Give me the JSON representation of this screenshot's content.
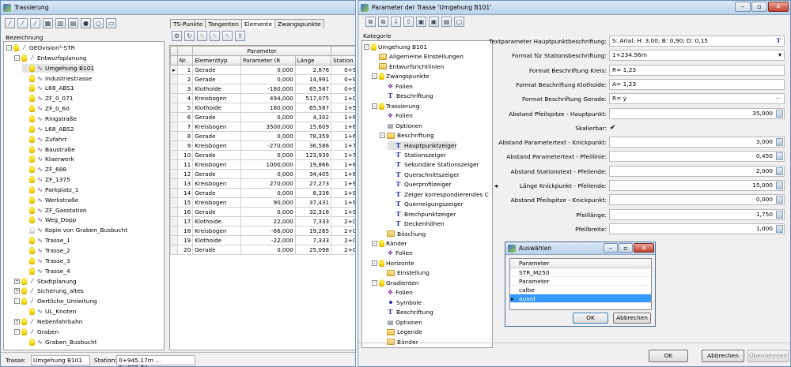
{
  "left": {
    "title": "Trassierung",
    "bezeichnung": "Bezeichnung",
    "tree": [
      {
        "label": "GEOvision³-STR",
        "lvl": 0,
        "t": "-",
        "b": 1,
        "k": "road"
      },
      {
        "label": "Entwurfsplanung",
        "lvl": 1,
        "t": "-",
        "b": 1,
        "k": "road"
      },
      {
        "label": "Umgehung B101",
        "lvl": 2,
        "b": 1,
        "k": "curve",
        "sel": 1
      },
      {
        "label": "Industriestrasse",
        "lvl": 2,
        "b": 1,
        "k": "curve"
      },
      {
        "label": "L68_ABS1",
        "lvl": 2,
        "b": 1,
        "k": "curve"
      },
      {
        "label": "ZF_0_071",
        "lvl": 2,
        "b": 1,
        "k": "curve"
      },
      {
        "label": "ZF_0_60",
        "lvl": 2,
        "b": 1,
        "k": "curve"
      },
      {
        "label": "Ringstraße",
        "lvl": 2,
        "b": 1,
        "k": "curve"
      },
      {
        "label": "L68_ABS2",
        "lvl": 2,
        "b": 1,
        "k": "curve"
      },
      {
        "label": "Zufahrt",
        "lvl": 2,
        "b": 1,
        "k": "curve"
      },
      {
        "label": "Baustraße",
        "lvl": 2,
        "b": 1,
        "k": "curve"
      },
      {
        "label": "Klaerwerk",
        "lvl": 2,
        "b": 1,
        "k": "curve"
      },
      {
        "label": "ZF_688",
        "lvl": 2,
        "b": 1,
        "k": "curve"
      },
      {
        "label": "ZF_1375",
        "lvl": 2,
        "b": 1,
        "k": "curve"
      },
      {
        "label": "Parkplatz_1",
        "lvl": 2,
        "b": 1,
        "k": "curve"
      },
      {
        "label": "Werkstraße",
        "lvl": 2,
        "b": 1,
        "k": "curve"
      },
      {
        "label": "ZF_Gasstation",
        "lvl": 2,
        "b": 1,
        "k": "curve"
      },
      {
        "label": "Weg_Dopp",
        "lvl": 2,
        "b": 1,
        "k": "curve"
      },
      {
        "label": "Kopie von Graben_Busbucht",
        "lvl": 2,
        "b": 0,
        "k": "curve"
      },
      {
        "label": "Trasse_1",
        "lvl": 2,
        "b": 1,
        "k": "curve"
      },
      {
        "label": "Trasse_2",
        "lvl": 2,
        "b": 1,
        "k": "curve"
      },
      {
        "label": "Trasse_3",
        "lvl": 2,
        "b": 1,
        "k": "curve"
      },
      {
        "label": "Trasse_4",
        "lvl": 2,
        "b": 1,
        "k": "curve"
      },
      {
        "label": "Stadtplanung",
        "lvl": 1,
        "t": "+",
        "b": 1,
        "k": "road"
      },
      {
        "label": "Sicherung_altes",
        "lvl": 1,
        "t": "+",
        "b": 1,
        "k": "road"
      },
      {
        "label": "Oertliche_Umleitung",
        "lvl": 1,
        "t": "-",
        "b": 1,
        "k": "road"
      },
      {
        "label": "UL_Knoten",
        "lvl": 2,
        "b": 1,
        "k": "curve"
      },
      {
        "label": "Nebenfahrbahn",
        "lvl": 1,
        "t": "+",
        "b": 1,
        "k": "road"
      },
      {
        "label": "Graben",
        "lvl": 1,
        "t": "-",
        "b": 1,
        "k": "road"
      },
      {
        "label": "Graben_Busbucht",
        "lvl": 2,
        "b": 1,
        "k": "curve"
      }
    ],
    "status_trasse_label": "Trasse:",
    "status_trasse": "Umgehung B101",
    "status_station_label": "Station:",
    "status_station": "0+945.17m ... 2+088.74m"
  },
  "mid": {
    "tabs": [
      "TS-Punkte",
      "Tangenten",
      "Elemente",
      "Zwangspunkte"
    ],
    "active_tab": 2,
    "group_header": "Parameter",
    "group_header2": "St",
    "cols": [
      "Nr.",
      "Elementtyp",
      "Parameter (R",
      "Länge",
      "Station Sta",
      "Radius Sta"
    ],
    "rows": [
      [
        "1",
        "Gerade",
        "0,000",
        "2,876",
        "0+945,17n",
        "0,000"
      ],
      [
        "2",
        "Gerade",
        "0,000",
        "14,991",
        "0+948,05n",
        "0,000"
      ],
      [
        "3",
        "Klothoide",
        "-180,000",
        "65,587",
        "0+963,04n",
        "0,000"
      ],
      [
        "4",
        "Kreisbogen",
        "494,000",
        "517,075",
        "1+028,62n",
        "494,000"
      ],
      [
        "5",
        "Klothoide",
        "180,000",
        "65,587",
        "1+545,70n",
        "494,000"
      ],
      [
        "6",
        "Gerade",
        "0,000",
        "4,302",
        "1+611,29n",
        "0,000"
      ],
      [
        "7",
        "Kreisbogen",
        "3500,000",
        "15,609",
        "1+615,59n",
        "3500,000"
      ],
      [
        "8",
        "Gerade",
        "0,000",
        "78,359",
        "1+631,20n",
        "0,000"
      ],
      [
        "9",
        "Kreisbogen",
        "-270,000",
        "36,586",
        "1+709,56n",
        "-270,000"
      ],
      [
        "10",
        "Gerade",
        "0,000",
        "123,939",
        "1+746,14n",
        "0,000"
      ],
      [
        "11",
        "Kreisbogen",
        "1000,000",
        "19,866",
        "1+870,08n",
        "1000,000"
      ],
      [
        "12",
        "Gerade",
        "0,000",
        "34,405",
        "1+889,95n",
        "0,000"
      ],
      [
        "13",
        "Kreisbogen",
        "270,000",
        "27,273",
        "1+924,35n",
        "270,000"
      ],
      [
        "14",
        "Gerade",
        "0,000",
        "8,336",
        "1+951,63n",
        "0,000"
      ],
      [
        "15",
        "Kreisbogen",
        "90,000",
        "37,431",
        "1+959,96n",
        "90,000"
      ],
      [
        "16",
        "Gerade",
        "0,000",
        "32,316",
        "1+997,39n",
        "0,000"
      ],
      [
        "17",
        "Klothoide",
        "22,000",
        "7,333",
        "2+029,71n",
        "0,000"
      ],
      [
        "18",
        "Kreisbogen",
        "-66,000",
        "19,265",
        "2+037,04n",
        "-66,000"
      ],
      [
        "19",
        "Klothoide",
        "-22,000",
        "7,333",
        "2+056,31n",
        "-66,000"
      ],
      [
        "20",
        "Gerade",
        "0,000",
        "25,098",
        "2+063,64n",
        "0,000"
      ]
    ]
  },
  "param": {
    "title": "Parameter der Trasse 'Umgehung B101'",
    "kategorie": "Kategorie",
    "tree": [
      {
        "label": "Umgehung B101",
        "lvl": 0,
        "t": "-",
        "k": "cat"
      },
      {
        "label": "Allgemeine Einstellungen",
        "lvl": 1,
        "k": "folder"
      },
      {
        "label": "Entwurfsrichtlinien",
        "lvl": 1,
        "k": "folder"
      },
      {
        "label": "Zwangspunkte",
        "lvl": 1,
        "t": "-",
        "k": "cat"
      },
      {
        "label": "Folien",
        "lvl": 2,
        "k": "layer"
      },
      {
        "label": "Beschriftung",
        "lvl": 2,
        "k": "T"
      },
      {
        "label": "Trassierung",
        "lvl": 1,
        "t": "-",
        "k": "cat"
      },
      {
        "label": "Folien",
        "lvl": 2,
        "k": "layer"
      },
      {
        "label": "Optionen",
        "lvl": 2,
        "k": "opt"
      },
      {
        "label": "Beschriftung",
        "lvl": 2,
        "t": "-",
        "k": "folder"
      },
      {
        "label": "Hauptpunktzeiger",
        "lvl": 3,
        "k": "T",
        "sel": 1
      },
      {
        "label": "Stationszeiger",
        "lvl": 3,
        "k": "T"
      },
      {
        "label": "Sekundäre Stationszeiger",
        "lvl": 3,
        "k": "T"
      },
      {
        "label": "Querschnittszeiger",
        "lvl": 3,
        "k": "T"
      },
      {
        "label": "Querprofilzeiger",
        "lvl": 3,
        "k": "T"
      },
      {
        "label": "Zeiger korrespondierendes C",
        "lvl": 3,
        "k": "T"
      },
      {
        "label": "Querneigungszeiger",
        "lvl": 3,
        "k": "T"
      },
      {
        "label": "Brechpunktzeiger",
        "lvl": 3,
        "k": "T"
      },
      {
        "label": "Deckenhöhen",
        "lvl": 3,
        "k": "T"
      },
      {
        "label": "Böschung",
        "lvl": 2,
        "k": "folder"
      },
      {
        "label": "Ränder",
        "lvl": 1,
        "t": "-",
        "k": "cat"
      },
      {
        "label": "Folien",
        "lvl": 2,
        "k": "layer"
      },
      {
        "label": "Horizonte",
        "lvl": 1,
        "t": "-",
        "k": "cat"
      },
      {
        "label": "Einstellung",
        "lvl": 2,
        "k": "folder"
      },
      {
        "label": "Gradienten",
        "lvl": 1,
        "t": "-",
        "k": "cat"
      },
      {
        "label": "Folien",
        "lvl": 2,
        "k": "layer"
      },
      {
        "label": "Symbole",
        "lvl": 2,
        "k": "dot"
      },
      {
        "label": "Beschriftung",
        "lvl": 2,
        "k": "T"
      },
      {
        "label": "Optionen",
        "lvl": 2,
        "k": "opt"
      },
      {
        "label": "Legende",
        "lvl": 2,
        "k": "folder"
      },
      {
        "label": "Bänder",
        "lvl": 2,
        "k": "folder"
      }
    ],
    "props": [
      {
        "label": "Textparameter Hauptpunktbeschriftung:",
        "value": "S: Arial; H: 3,00; B: 0,90; D: 0,15",
        "kind": "T"
      },
      {
        "label": "Format für Stationsbeschriftung:",
        "value": "1+234.56m",
        "kind": "dd"
      },
      {
        "label": "Format Beschriftung Kreis:",
        "value": "R= 1,23",
        "kind": "txt"
      },
      {
        "label": "Format Beschriftung Klothoide:",
        "value": "A= 1,23",
        "kind": "txt"
      },
      {
        "label": "Format Beschriftung Gerade:",
        "value": "R= ý",
        "kind": "dots"
      },
      {
        "label": "Abstand Pfeilspitze - Hauptpunkt:",
        "value": "35,000",
        "kind": "num"
      },
      {
        "label": "Skalierbar:",
        "value": "✔",
        "kind": "chk"
      },
      {
        "label": "Abstand Parametertext - Knickpunkt:",
        "value": "3,000",
        "kind": "num"
      },
      {
        "label": "Abstand Parametertext - Pfeillinie:",
        "value": "0,450",
        "kind": "num"
      },
      {
        "label": "Abstand Stationstext - Pfeilende:",
        "value": "2,000",
        "kind": "num"
      },
      {
        "label": "Länge Knickpunkt - Pfeilende:",
        "value": "15,000",
        "kind": "num"
      },
      {
        "label": "Abstand Pfeilspitze - Knickpunkt:",
        "value": "0,000",
        "kind": "num"
      },
      {
        "label": "Pfeillänge:",
        "value": "1,750",
        "kind": "num"
      },
      {
        "label": "Pfeilbreite:",
        "value": "1,000",
        "kind": "num"
      }
    ],
    "ok": "OK",
    "cancel": "Abbrechen",
    "apply": "Übernehmen"
  },
  "dlg": {
    "title": "Auswählen",
    "header": "Parameter",
    "items": [
      "STR_M250",
      "Parameter",
      "calbe",
      "ausrd"
    ],
    "selected": 3,
    "ok": "OK",
    "cancel": "Abbrechen"
  }
}
